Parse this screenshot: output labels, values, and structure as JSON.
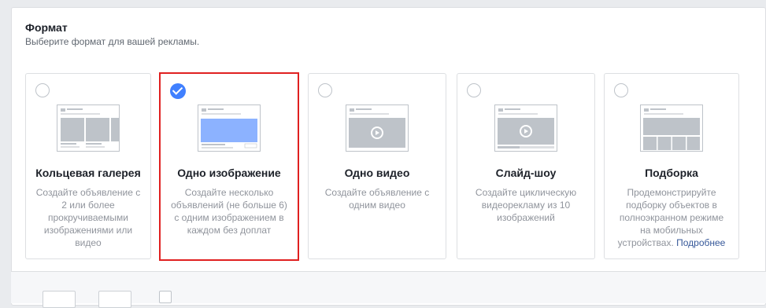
{
  "section": {
    "title": "Формат",
    "subtitle": "Выберите формат для вашей рекламы."
  },
  "formats": [
    {
      "title": "Кольцевая галерея",
      "description": "Создайте объявление с 2 или более прокручиваемыми изображениями или видео",
      "selected": false,
      "icon": "carousel-illustration"
    },
    {
      "title": "Одно изображение",
      "description": "Создайте несколько объявлений (не больше 6) с одним изображением в каждом без доплат",
      "selected": true,
      "icon": "single-image-illustration"
    },
    {
      "title": "Одно видео",
      "description": "Создайте объявление с одним видео",
      "selected": false,
      "icon": "single-video-illustration"
    },
    {
      "title": "Слайд-шоу",
      "description": "Создайте циклическую видеорекламу из 10 изображений",
      "selected": false,
      "icon": "slideshow-illustration"
    },
    {
      "title": "Подборка",
      "description": "Продемонстрируйте подборку объектов в полноэкранном режиме на мобильных устройствах.",
      "link": "Подробнее",
      "selected": false,
      "icon": "collection-illustration"
    }
  ],
  "colors": {
    "accent": "#4080ff",
    "selected_border": "#e02020",
    "placeholder": "#bec3c9"
  }
}
